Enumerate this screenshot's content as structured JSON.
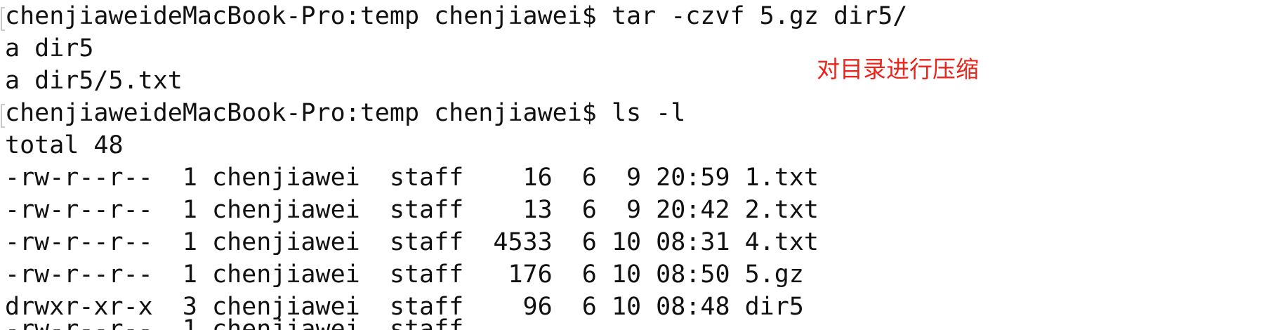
{
  "terminal": {
    "lines": [
      "chenjiaweideMacBook-Pro:temp chenjiawei$ tar -czvf 5.gz dir5/",
      "a dir5",
      "a dir5/5.txt",
      "chenjiaweideMacBook-Pro:temp chenjiawei$ ls -l",
      "total 48",
      "-rw-r--r--  1 chenjiawei  staff    16  6  9 20:59 1.txt",
      "-rw-r--r--  1 chenjiawei  staff    13  6  9 20:42 2.txt",
      "-rw-r--r--  1 chenjiawei  staff  4533  6 10 08:31 4.txt",
      "-rw-r--r--  1 chenjiawei  staff   176  6 10 08:50 5.gz",
      "drwxr-xr-x  3 chenjiawei  staff    96  6 10 08:48 dir5"
    ],
    "partial_last_line": "-rw-r--r--  1 chenjiawei  staff"
  },
  "annotation": {
    "text": "对目录进行压缩",
    "color": "#e8261c"
  },
  "colors": {
    "background": "#ffffff",
    "text": "#111111"
  }
}
